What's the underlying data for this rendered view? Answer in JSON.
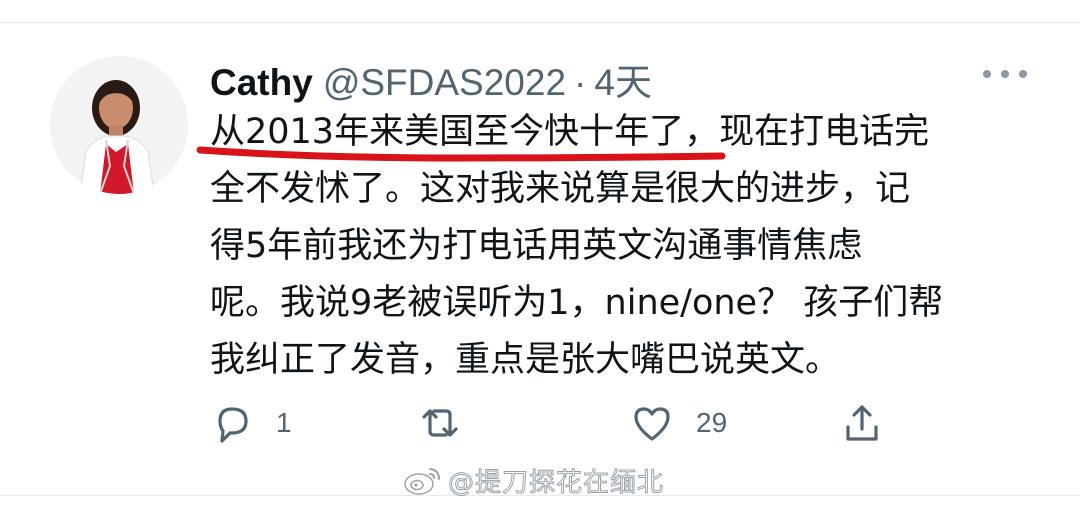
{
  "tweet": {
    "author_name": "Cathy",
    "author_handle": "@SFDAS2022",
    "separator": "·",
    "time": "4天",
    "text_lines": [
      "从2013年来美国至今快十年了，现在打电话完",
      "全不发怵了。这对我来说算是很大的进步，记",
      "得5年前我还为打电话用英文沟通事情焦虑",
      "呢。我说9老被误听为1，nine/one？ 孩子们帮",
      "我纠正了发音，重点是张大嘴巴说英文。"
    ],
    "reply_count": "1",
    "retweet_count": "",
    "like_count": "29",
    "icons": {
      "more": "more-horizontal-icon",
      "reply": "reply-icon",
      "retweet": "retweet-icon",
      "like": "heart-icon",
      "share": "share-icon"
    }
  },
  "watermark": {
    "text": "@提刀探花在缅北",
    "icon": "weibo-logo-icon"
  },
  "colors": {
    "text_primary": "#0f1419",
    "text_secondary": "#536471",
    "icon_gray": "#536471",
    "annotation_red": "#d8141a"
  }
}
